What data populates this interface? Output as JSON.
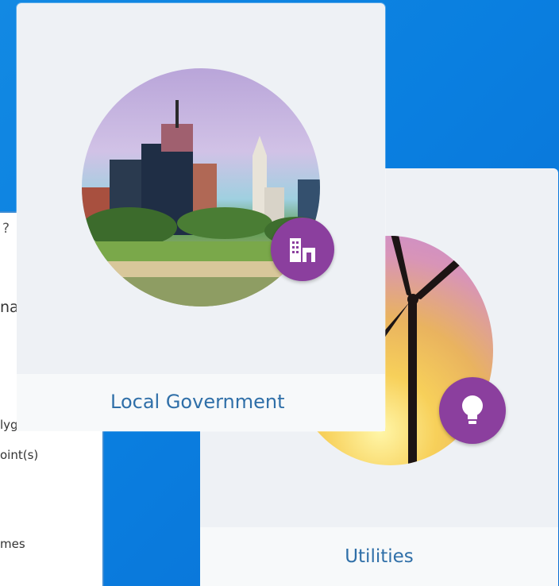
{
  "panel": {
    "help_glyph": "?",
    "close_glyph": "×",
    "title_fragment": "nation",
    "rows": [
      "lygon",
      "oint(s)",
      "mes"
    ]
  },
  "cards": {
    "local_government": {
      "label": "Local Government",
      "icon": "building-icon"
    },
    "utilities": {
      "label": "Utilities",
      "icon": "lightbulb-icon"
    }
  },
  "colors": {
    "desktop_blue": "#0a7fe0",
    "badge_purple": "#8b3f9e",
    "label_blue": "#2f6fa8",
    "card_bg": "#eef1f5"
  }
}
